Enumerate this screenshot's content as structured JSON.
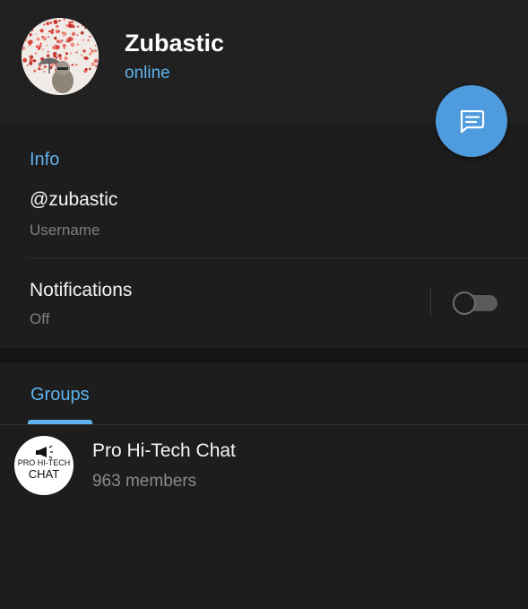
{
  "profile": {
    "name": "Zubastic",
    "status": "online"
  },
  "info": {
    "section_title": "Info",
    "username": "@zubastic",
    "username_label": "Username",
    "notifications": {
      "title": "Notifications",
      "status": "Off",
      "enabled": false
    }
  },
  "groups": {
    "tab_label": "Groups",
    "items": [
      {
        "name": "Pro Hi-Tech Chat",
        "members": "963 members",
        "avatar_text_top": "PRO HI-TECH",
        "avatar_text_bottom": "CHAT"
      }
    ]
  },
  "icons": {
    "fab": "message-icon",
    "group_avatar": "megaphone-icon"
  },
  "colors": {
    "accent": "#5fb2ee",
    "fab": "#4e9bde",
    "background": "#1d1d1d",
    "header": "#212121"
  }
}
